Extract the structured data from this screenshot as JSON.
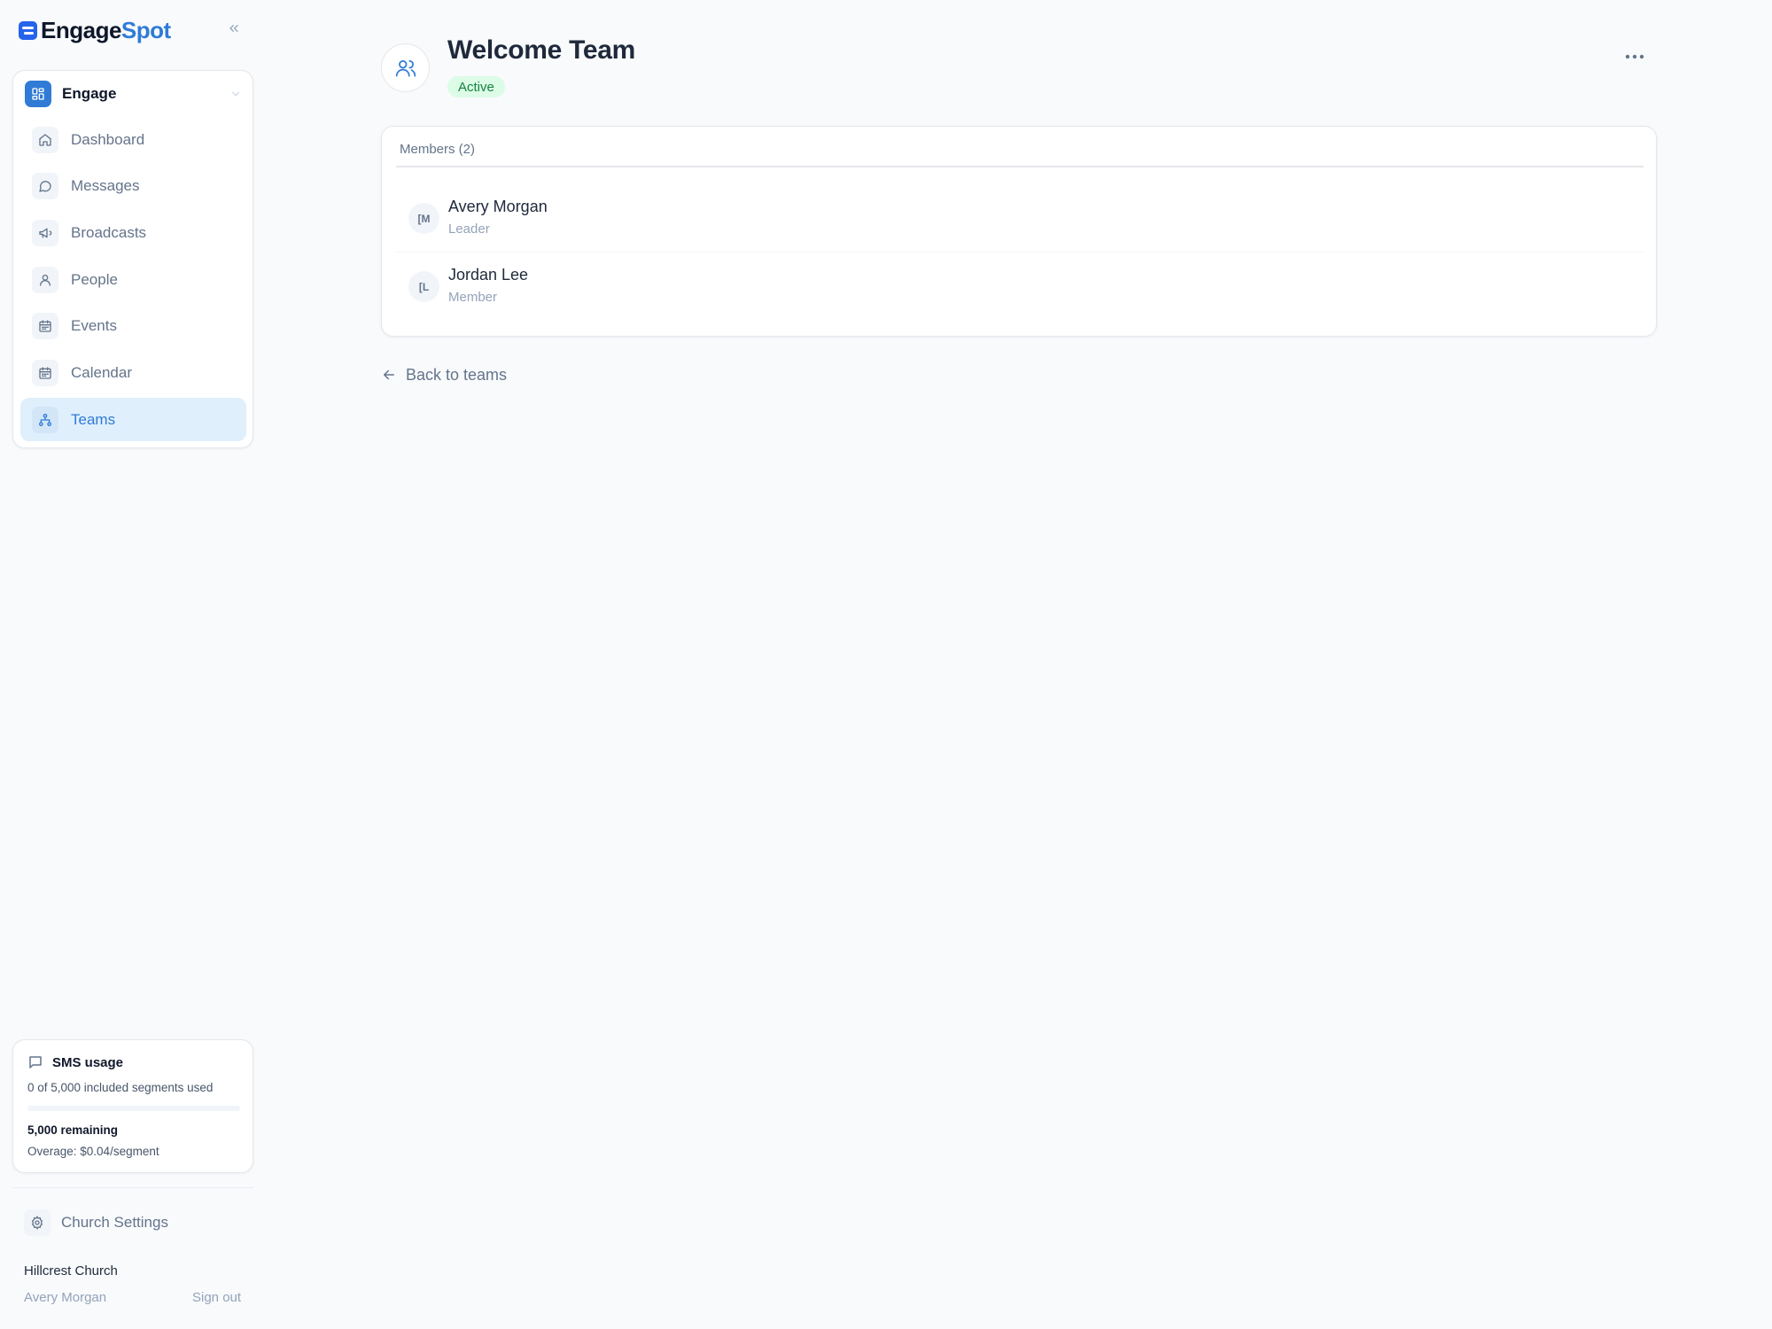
{
  "brand": {
    "name_part1": "Engage",
    "name_part2": "Spot",
    "accent": "#2f7bd6"
  },
  "sidebar": {
    "collapse_icon": "chevrons-left-icon",
    "section": {
      "title": "Engage",
      "icon": "dashboard-grid-icon"
    },
    "items": [
      {
        "label": "Dashboard",
        "icon": "home-icon",
        "active": false
      },
      {
        "label": "Messages",
        "icon": "message-circle-icon",
        "active": false
      },
      {
        "label": "Broadcasts",
        "icon": "megaphone-icon",
        "active": false
      },
      {
        "label": "People",
        "icon": "user-icon",
        "active": false
      },
      {
        "label": "Events",
        "icon": "calendar-icon",
        "active": false
      },
      {
        "label": "Calendar",
        "icon": "calendar-icon",
        "active": false
      },
      {
        "label": "Teams",
        "icon": "org-chart-icon",
        "active": true
      }
    ],
    "sms": {
      "title": "SMS usage",
      "used_text": "0 of 5,000 included segments used",
      "used_fraction": 0,
      "remaining": "5,000 remaining",
      "overage": "Overage: $0.04/segment"
    },
    "settings_label": "Church Settings",
    "church_name": "Hillcrest Church",
    "user_name": "Avery Morgan",
    "sign_out": "Sign out"
  },
  "team": {
    "title": "Welcome Team",
    "status": "Active",
    "status_color": "#15803d",
    "icon": "users-icon",
    "more_icon": "more-horizontal-icon"
  },
  "members": {
    "header": "Members (2)",
    "list": [
      {
        "initials": "[M",
        "name": "Avery Morgan",
        "role": "Leader"
      },
      {
        "initials": "[L",
        "name": "Jordan Lee",
        "role": "Member"
      }
    ]
  },
  "back_link": {
    "label": "Back to teams",
    "icon": "arrow-left-icon"
  }
}
